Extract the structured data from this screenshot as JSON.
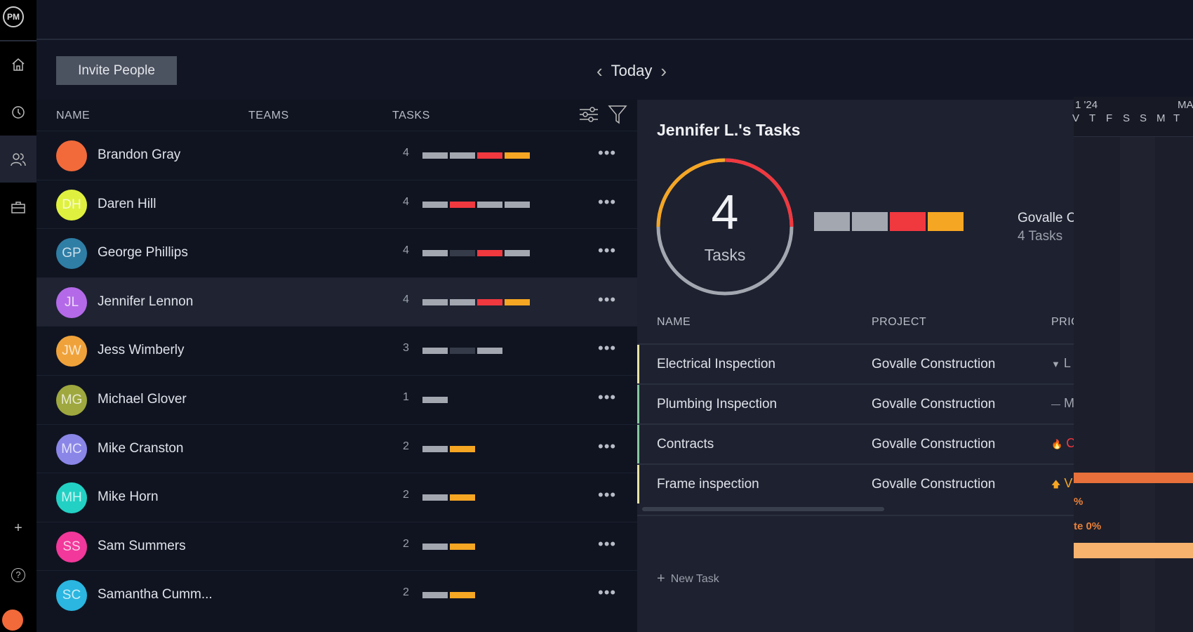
{
  "sidebar": {
    "logo": "PM",
    "items": [
      "home",
      "time",
      "people",
      "portfolio"
    ],
    "active": "people"
  },
  "toolbar": {
    "invite_label": "Invite People",
    "date_label": "Today"
  },
  "people_table": {
    "columns": [
      "NAME",
      "TEAMS",
      "TASKS"
    ],
    "rows": [
      {
        "initials": "",
        "name": "Brandon Gray",
        "count": "4",
        "color": "#f26a3a",
        "bars": [
          "gray",
          "gray",
          "red",
          "orange"
        ]
      },
      {
        "initials": "DH",
        "name": "Daren Hill",
        "count": "4",
        "color": "#dff13e",
        "bars": [
          "gray",
          "red",
          "gray",
          "gray"
        ]
      },
      {
        "initials": "GP",
        "name": "George Phillips",
        "count": "4",
        "color": "#2f7ea6",
        "bars": [
          "gray",
          "dark",
          "red",
          "gray"
        ]
      },
      {
        "initials": "JL",
        "name": "Jennifer Lennon",
        "count": "4",
        "color": "#b46ae8",
        "bars": [
          "gray",
          "gray",
          "red",
          "orange"
        ]
      },
      {
        "initials": "JW",
        "name": "Jess Wimberly",
        "count": "3",
        "color": "#f0a23a",
        "bars": [
          "gray",
          "dark",
          "gray"
        ]
      },
      {
        "initials": "MG",
        "name": "Michael Glover",
        "count": "1",
        "color": "#9ea83e",
        "bars": [
          "gray"
        ]
      },
      {
        "initials": "MC",
        "name": "Mike Cranston",
        "count": "2",
        "color": "#8a86e8",
        "bars": [
          "gray",
          "orange"
        ]
      },
      {
        "initials": "MH",
        "name": "Mike Horn",
        "count": "2",
        "color": "#22d1c4",
        "bars": [
          "gray",
          "orange"
        ]
      },
      {
        "initials": "SS",
        "name": "Sam Summers",
        "count": "2",
        "color": "#f2389a",
        "bars": [
          "gray",
          "orange"
        ]
      },
      {
        "initials": "SC",
        "name": "Samantha Cumm...",
        "count": "2",
        "color": "#2ab6e0",
        "bars": [
          "gray",
          "orange"
        ]
      }
    ],
    "selected": "Jennifer Lennon"
  },
  "bar_colors": {
    "gray": "#a3a7b0",
    "dark": "#363b49",
    "red": "#f0383f",
    "orange": "#f5a623"
  },
  "task_panel": {
    "title": "Jennifer L.'s Tasks",
    "total": "4",
    "total_label": "Tasks",
    "summary_bars": [
      "gray",
      "gray",
      "red",
      "orange"
    ],
    "project_name": "Govalle C",
    "project_tasks": "4 Tasks",
    "columns": [
      "NAME",
      "PROJECT",
      "PRIO"
    ],
    "tasks": [
      {
        "name": "Electrical Inspection",
        "project": "Govalle Construction",
        "priority": "L",
        "priority_icon": "arrow-down",
        "priority_color": "#a3a7b0",
        "border": "#e9e3a6"
      },
      {
        "name": "Plumbing Inspection",
        "project": "Govalle Construction",
        "priority": "M",
        "priority_icon": "dash",
        "priority_color": "#a3a7b0",
        "border": "#86c9a0"
      },
      {
        "name": "Contracts",
        "project": "Govalle Construction",
        "priority": "C",
        "priority_icon": "fire",
        "priority_color": "#f0383f",
        "border": "#86c9a0"
      },
      {
        "name": "Frame inspection",
        "project": "Govalle Construction",
        "priority": "V",
        "priority_icon": "arrow-up",
        "priority_color": "#f5a623",
        "border": "#e9e3a6"
      }
    ],
    "new_task_label": "New Task"
  },
  "gantt": {
    "month_left": "1 '24",
    "month_right": "MAY",
    "days": [
      "V",
      "T",
      "F",
      "S",
      "S",
      "M",
      "T"
    ],
    "label1": "%",
    "label2": "te 0%",
    "bar_colors": [
      "#e8703a",
      "#f7b26e"
    ]
  }
}
